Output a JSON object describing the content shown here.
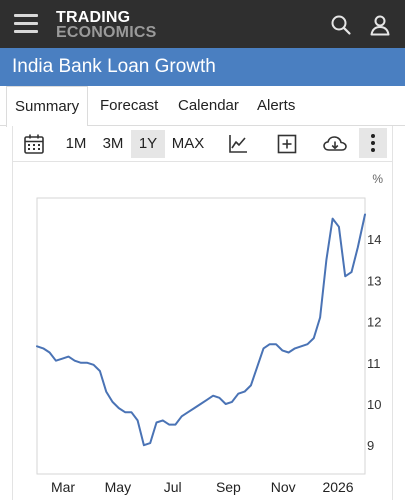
{
  "header": {
    "logo_line1": "TRADING",
    "logo_line2": "ECONOMICS"
  },
  "title": "India Bank Loan Growth",
  "tabs": [
    {
      "label": "Summary",
      "active": true
    },
    {
      "label": "Forecast"
    },
    {
      "label": "Calendar"
    },
    {
      "label": "Alerts"
    }
  ],
  "toolbar": {
    "ranges": [
      "1M",
      "3M",
      "1Y",
      "MAX"
    ],
    "selected_range": "1Y",
    "icons": [
      "calendar-icon",
      "line-chart-icon",
      "add-box-icon",
      "cloud-download-icon",
      "more-vert-icon"
    ]
  },
  "colors": {
    "header_bg": "#2f2f2f",
    "title_bg": "#4a7fc1",
    "line": "#4a73b5"
  },
  "chart_data": {
    "type": "line",
    "ylabel": "%",
    "ylim": [
      8.3,
      15.0
    ],
    "yticks": [
      9,
      10,
      11,
      12,
      13,
      14
    ],
    "xtick_labels": [
      "Mar",
      "May",
      "Jul",
      "Sep",
      "Nov",
      "2026"
    ],
    "x_start": "2025-01-31",
    "x_end": "2026-01-31",
    "xtick_dates": [
      "2025-03-01",
      "2025-05-01",
      "2025-07-01",
      "2025-09-01",
      "2025-11-01",
      "2026-01-01"
    ],
    "series": [
      {
        "name": "",
        "points": [
          [
            "2025-01-31",
            11.4
          ],
          [
            "2025-02-07",
            11.35
          ],
          [
            "2025-02-14",
            11.25
          ],
          [
            "2025-02-21",
            11.05
          ],
          [
            "2025-02-28",
            11.1
          ],
          [
            "2025-03-07",
            11.15
          ],
          [
            "2025-03-14",
            11.05
          ],
          [
            "2025-03-21",
            11.0
          ],
          [
            "2025-03-28",
            11.0
          ],
          [
            "2025-04-04",
            10.95
          ],
          [
            "2025-04-11",
            10.8
          ],
          [
            "2025-04-18",
            10.3
          ],
          [
            "2025-04-25",
            10.05
          ],
          [
            "2025-05-02",
            9.9
          ],
          [
            "2025-05-09",
            9.8
          ],
          [
            "2025-05-16",
            9.8
          ],
          [
            "2025-05-23",
            9.6
          ],
          [
            "2025-05-30",
            9.0
          ],
          [
            "2025-06-06",
            9.05
          ],
          [
            "2025-06-13",
            9.55
          ],
          [
            "2025-06-20",
            9.6
          ],
          [
            "2025-06-27",
            9.5
          ],
          [
            "2025-07-04",
            9.5
          ],
          [
            "2025-07-11",
            9.7
          ],
          [
            "2025-07-18",
            9.8
          ],
          [
            "2025-07-25",
            9.9
          ],
          [
            "2025-08-01",
            10.0
          ],
          [
            "2025-08-08",
            10.1
          ],
          [
            "2025-08-15",
            10.2
          ],
          [
            "2025-08-22",
            10.15
          ],
          [
            "2025-08-29",
            10.0
          ],
          [
            "2025-09-05",
            10.05
          ],
          [
            "2025-09-12",
            10.25
          ],
          [
            "2025-09-19",
            10.3
          ],
          [
            "2025-09-26",
            10.45
          ],
          [
            "2025-10-03",
            10.9
          ],
          [
            "2025-10-10",
            11.35
          ],
          [
            "2025-10-17",
            11.45
          ],
          [
            "2025-10-24",
            11.45
          ],
          [
            "2025-10-31",
            11.3
          ],
          [
            "2025-11-07",
            11.25
          ],
          [
            "2025-11-14",
            11.35
          ],
          [
            "2025-11-21",
            11.4
          ],
          [
            "2025-11-28",
            11.45
          ],
          [
            "2025-12-05",
            11.6
          ],
          [
            "2025-12-12",
            12.1
          ],
          [
            "2025-12-19",
            13.5
          ],
          [
            "2025-12-26",
            14.5
          ],
          [
            "2026-01-02",
            14.3
          ],
          [
            "2026-01-09",
            13.1
          ],
          [
            "2026-01-16",
            13.2
          ],
          [
            "2026-01-23",
            13.8
          ],
          [
            "2026-01-31",
            14.6
          ]
        ]
      }
    ]
  }
}
